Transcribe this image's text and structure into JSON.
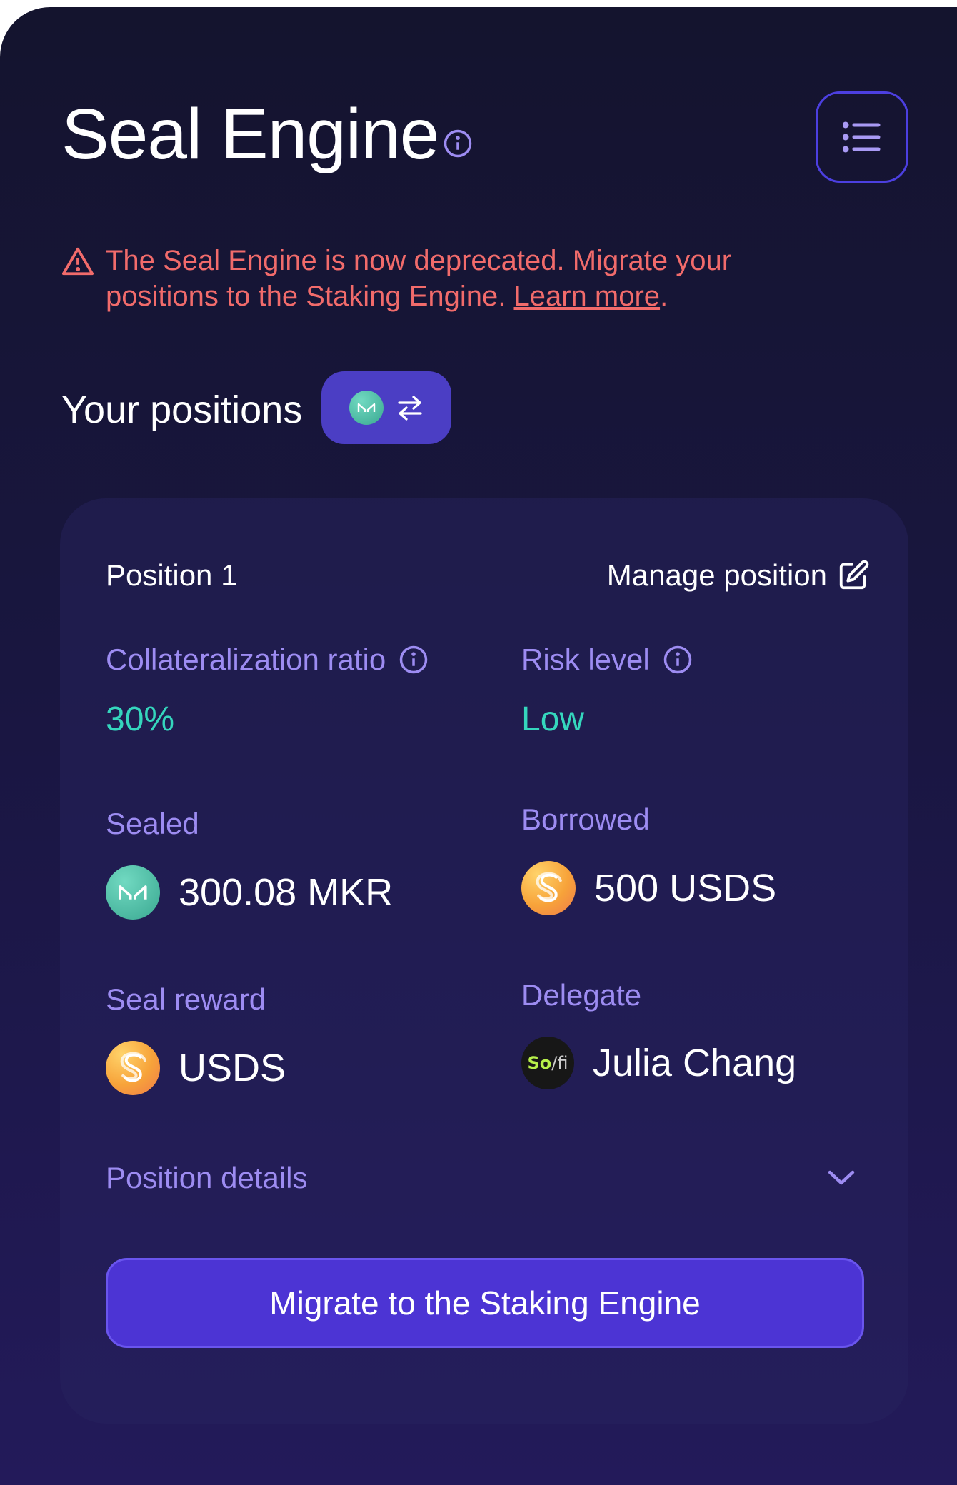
{
  "header": {
    "title": "Seal Engine",
    "info_icon": "info-icon",
    "menu_icon": "list-icon"
  },
  "warning": {
    "text": "The Seal Engine is now deprecated. Migrate your positions to the Staking Engine.",
    "link_label": "Learn more",
    "trailing": ".",
    "icon": "warning-triangle-icon",
    "color": "#f16b6b"
  },
  "positions": {
    "label": "Your positions",
    "switch_icons": [
      "mkr-token-icon",
      "swap-arrows-icon"
    ]
  },
  "position": {
    "title": "Position 1",
    "manage_label": "Manage position",
    "collateralization_label": "Collateralization ratio",
    "collateralization_value": "30%",
    "risk_label": "Risk level",
    "risk_value": "Low",
    "sealed_label": "Sealed",
    "sealed_value": "300.08 MKR",
    "borrowed_label": "Borrowed",
    "borrowed_value": "500 USDS",
    "reward_label": "Seal reward",
    "reward_value": "USDS",
    "delegate_label": "Delegate",
    "delegate_value": "Julia Chang",
    "delegate_avatar_so": "So",
    "delegate_avatar_fi": "/fi",
    "details_label": "Position details",
    "migrate_label": "Migrate to the Staking Engine"
  },
  "colors": {
    "accent": "#4c34d4",
    "label": "#9d8cf2",
    "positive": "#35d6bd"
  }
}
